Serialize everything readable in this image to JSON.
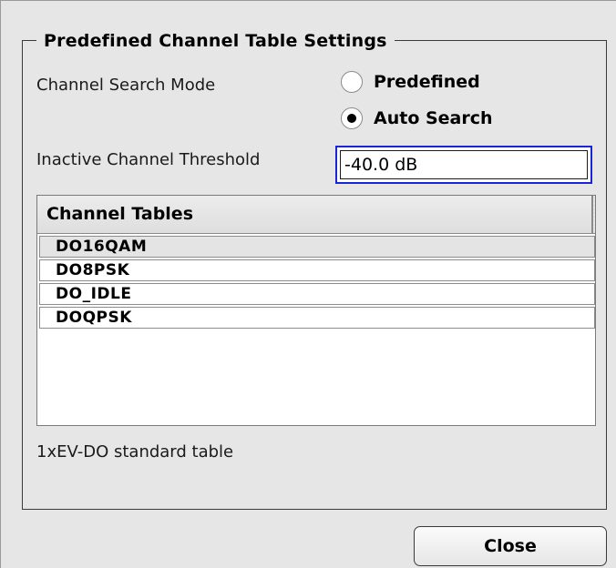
{
  "dialog": {
    "group_title": "Predefined Channel Table Settings",
    "channel_search_mode": {
      "label": "Channel Search Mode",
      "options": [
        {
          "label": "Predefined",
          "checked": false
        },
        {
          "label": "Auto Search",
          "checked": true
        }
      ]
    },
    "inactive_threshold": {
      "label": "Inactive Channel Threshold",
      "value": "-40.0 dB"
    },
    "channel_tables": {
      "header": "Channel Tables",
      "rows": [
        "DO16QAM",
        "DO8PSK",
        "DO_IDLE",
        "DOQPSK"
      ],
      "selected_index": 0
    },
    "hint": "1xEV-DO standard table",
    "close_label": "Close"
  },
  "colors": {
    "background": "#e6e6e6",
    "focus_border": "#1a24d8"
  }
}
